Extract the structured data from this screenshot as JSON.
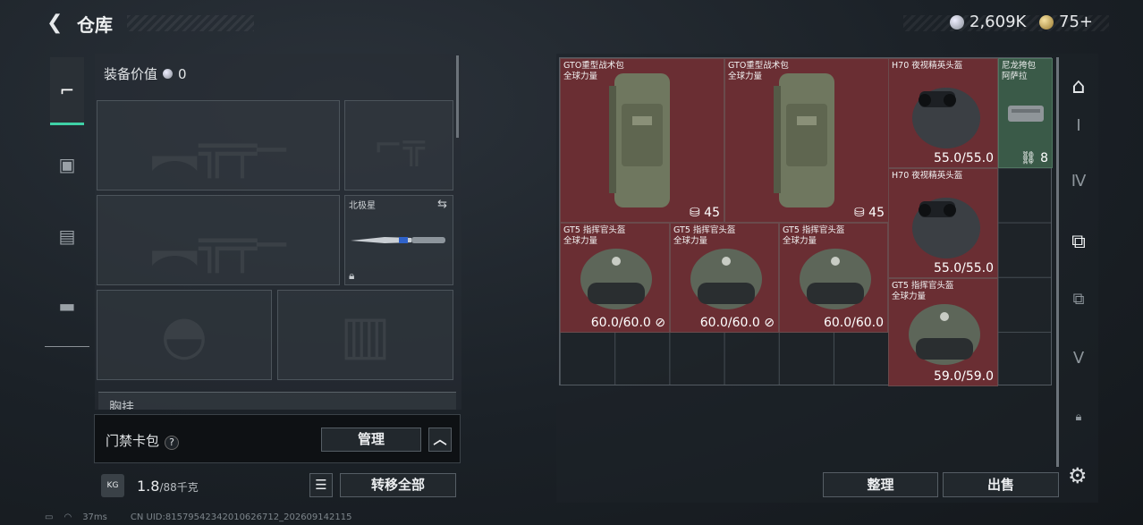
{
  "header": {
    "back_icon": "back-arrow-icon",
    "title": "仓库"
  },
  "currency": {
    "silver": "2,609K",
    "gold": "75+"
  },
  "equipment": {
    "value_label": "装备价值",
    "value": "0",
    "slots": [
      {
        "label": "",
        "icon": "rifle-silhouette"
      },
      {
        "label": "",
        "icon": "pistol-silhouette"
      },
      {
        "label": "",
        "icon": "rifle-silhouette"
      },
      {
        "label": "北极星",
        "icon": "knife"
      },
      {
        "label": "",
        "icon": "helmet-silhouette"
      },
      {
        "label": "",
        "icon": "vest-silhouette"
      }
    ],
    "chest_label": "胸挂"
  },
  "access_card": {
    "label": "门禁卡包",
    "manage_label": "管理"
  },
  "weight": {
    "value": "1.8",
    "unit": "/88千克"
  },
  "buttons": {
    "transfer_all": "转移全部",
    "sort": "整理",
    "sell": "出售"
  },
  "items": [
    {
      "name": "GTO重型战术包",
      "sub": "全球力量",
      "value": "45",
      "type": "backpack"
    },
    {
      "name": "GTO重型战术包",
      "sub": "全球力量",
      "value": "45",
      "type": "backpack"
    },
    {
      "name": "H70 夜视精英头盔",
      "sub": "",
      "value": "55.0/55.0",
      "type": "nvg-helmet"
    },
    {
      "name": "尼龙挎包",
      "sub": "阿萨拉",
      "value": "8",
      "type": "bag"
    },
    {
      "name": "H70 夜视精英头盔",
      "sub": "",
      "value": "55.0/55.0",
      "type": "nvg-helmet"
    },
    {
      "name": "GT5 指挥官头盔",
      "sub": "全球力量",
      "value": "60.0/60.0",
      "type": "helmet"
    },
    {
      "name": "GT5 指挥官头盔",
      "sub": "全球力量",
      "value": "60.0/60.0",
      "type": "helmet"
    },
    {
      "name": "GT5 指挥官头盔",
      "sub": "全球力量",
      "value": "60.0/60.0",
      "type": "helmet"
    },
    {
      "name": "GT5 指挥官头盔",
      "sub": "全球力量",
      "value": "59.0/59.0",
      "type": "helmet"
    }
  ],
  "status": {
    "ping": "37ms",
    "uid": "CN UID:8157954234201062671​2_202609142115"
  },
  "colors": {
    "accent": "#3fd1a6",
    "item_red": "#6a2e33",
    "item_green": "#3a5a48"
  }
}
